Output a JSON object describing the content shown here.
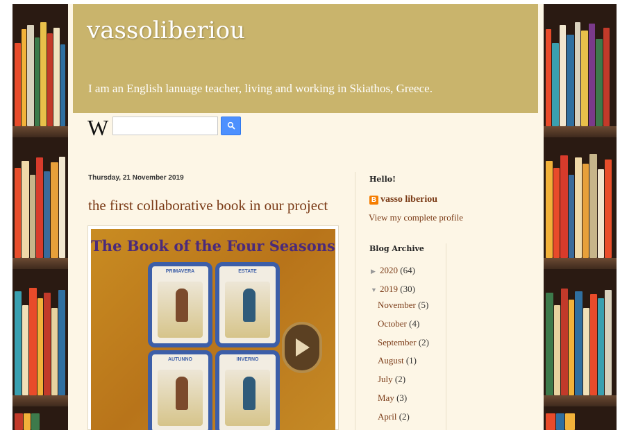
{
  "header": {
    "title": "vassoliberiou",
    "description": "I am an English lanuage teacher, living and working in Skiathos, Greece."
  },
  "search": {
    "logo": "W",
    "placeholder": "",
    "icon": "search-icon"
  },
  "post": {
    "date": "Thursday, 21 November 2019",
    "title": "the first collaborative book in our project",
    "image": {
      "heading": "The Book of the Four Seasons",
      "tiles": [
        "PRIMAVERA",
        "ESTATE",
        "AUTUNNO",
        "INVERNO"
      ],
      "play_icon": "play-icon"
    }
  },
  "sidebar": {
    "profile_heading": "Hello!",
    "profile_name": "vasso liberiou",
    "profile_link": "View my complete profile",
    "archive_heading": "Blog Archive",
    "archive": [
      {
        "label": "2020",
        "count": "(64)",
        "toggle": "▶"
      },
      {
        "label": "2019",
        "count": "(30)",
        "toggle": "▼"
      },
      {
        "label": "November",
        "count": "(5)"
      },
      {
        "label": "October",
        "count": "(4)"
      },
      {
        "label": "September",
        "count": "(2)"
      },
      {
        "label": "August",
        "count": "(1)"
      },
      {
        "label": "July",
        "count": "(2)"
      },
      {
        "label": "May",
        "count": "(3)"
      },
      {
        "label": "April",
        "count": "(2)"
      }
    ]
  },
  "colors": {
    "header_bg": "#c9b46c",
    "page_bg": "#fdf6e6",
    "link": "#7a3a16",
    "search_button": "#4d90fe"
  }
}
